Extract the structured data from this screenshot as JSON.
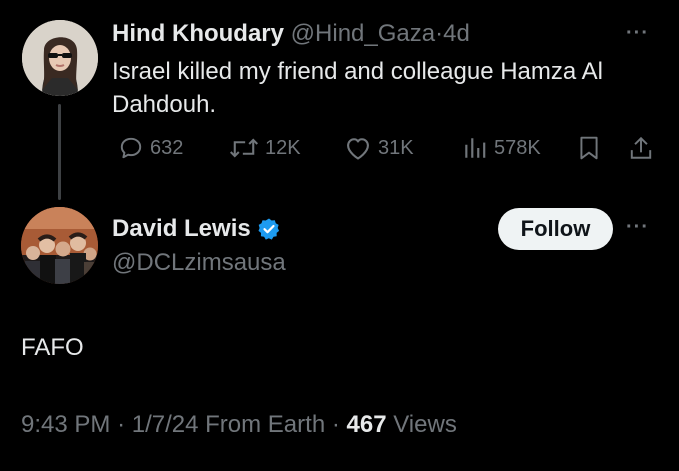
{
  "parent_tweet": {
    "author_name": "Hind Khoudary",
    "handle": "@Hind_Gaza",
    "separator": "·",
    "time_ago": "4d",
    "text": "Israel killed my friend and colleague Hamza Al Dahdouh.",
    "more_menu": "···",
    "actions": {
      "replies": "632",
      "reposts": "12K",
      "likes": "31K",
      "views": "578K"
    }
  },
  "reply_tweet": {
    "author_name": "David Lewis",
    "verified": true,
    "handle": "@DCLzimsausa",
    "follow_label": "Follow",
    "more_menu": "···",
    "text": "FAFO",
    "time": "9:43 PM",
    "date": "1/7/24",
    "source": "From Earth",
    "separator": "·",
    "views_count": "467",
    "views_label": "Views"
  },
  "colors": {
    "background": "#000000",
    "primary_text": "#e7e9ea",
    "muted_text": "#71767b",
    "verified_blue": "#1d9bf0",
    "follow_bg": "#eff3f4",
    "follow_text": "#0f1419"
  }
}
